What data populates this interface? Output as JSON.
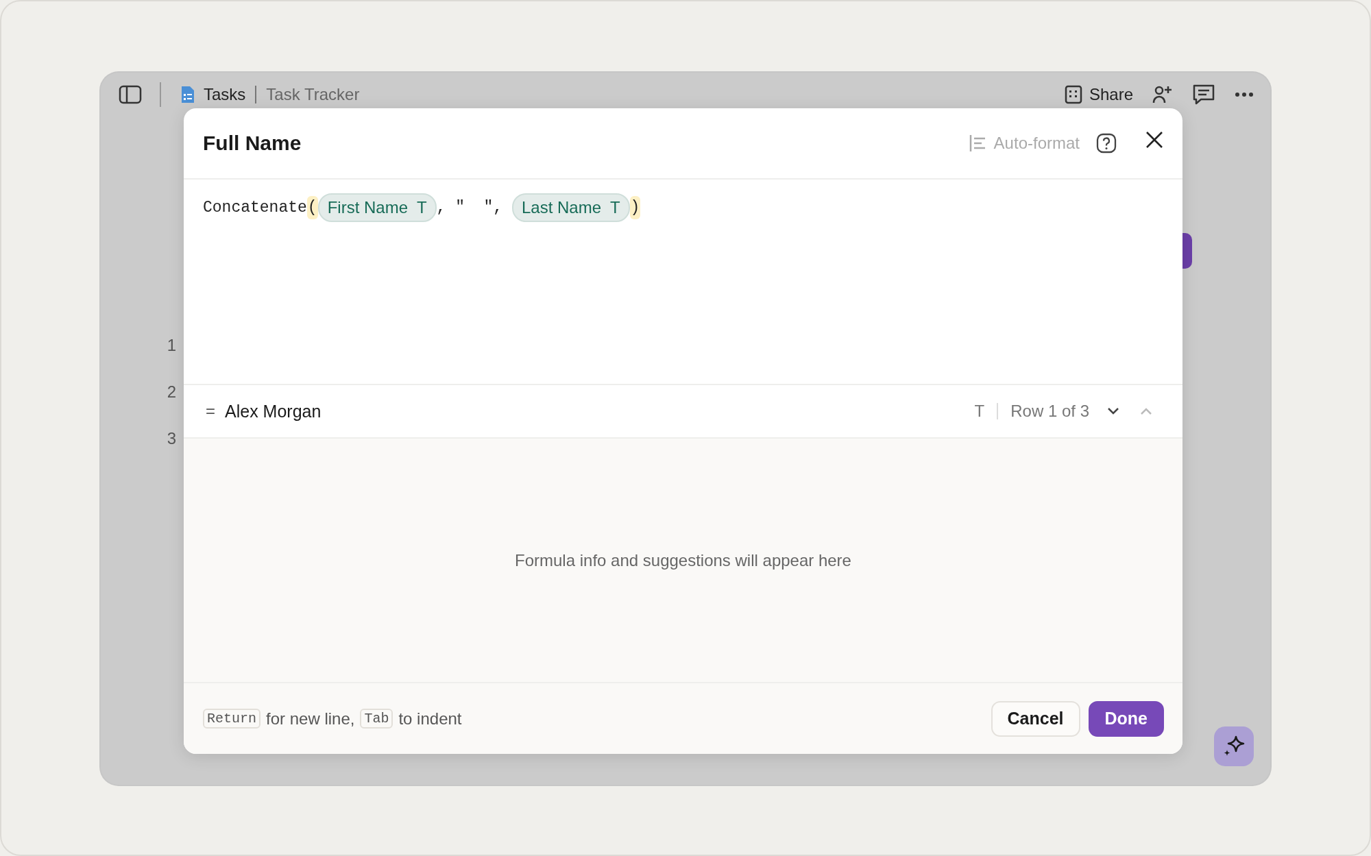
{
  "toolbar": {
    "breadcrumb": [
      {
        "label": "Tasks",
        "kind": "doc"
      },
      {
        "label": "Task Tracker",
        "kind": "page"
      }
    ],
    "share_label": "Share"
  },
  "row_numbers": [
    "1",
    "2",
    "3"
  ],
  "dialog": {
    "title": "Full Name",
    "auto_format": {
      "label": "Auto-format",
      "disabled": true
    },
    "formula": [
      {
        "kind": "code",
        "text": "Concatenate"
      },
      {
        "kind": "paren",
        "text": "("
      },
      {
        "kind": "field",
        "text": "First Name",
        "type_glyph": "T"
      },
      {
        "kind": "code",
        "text": ", \"  \", "
      },
      {
        "kind": "field",
        "text": "Last Name",
        "type_glyph": "T"
      },
      {
        "kind": "paren",
        "text": ")"
      }
    ],
    "preview": {
      "prefix": "=",
      "value": "Alex Morgan",
      "type_glyph": "T",
      "row_label": "Row 1 of 3",
      "next_enabled": true,
      "prev_enabled": false
    },
    "info": "Formula info and suggestions will appear here",
    "hint": [
      {
        "kind": "key",
        "text": "Return"
      },
      {
        "kind": "text",
        "text": "for new line,"
      },
      {
        "kind": "key",
        "text": "Tab"
      },
      {
        "kind": "text",
        "text": "to indent"
      }
    ],
    "buttons": [
      {
        "kind": "secondary",
        "label": "Cancel"
      },
      {
        "kind": "primary",
        "label": "Done"
      }
    ]
  }
}
